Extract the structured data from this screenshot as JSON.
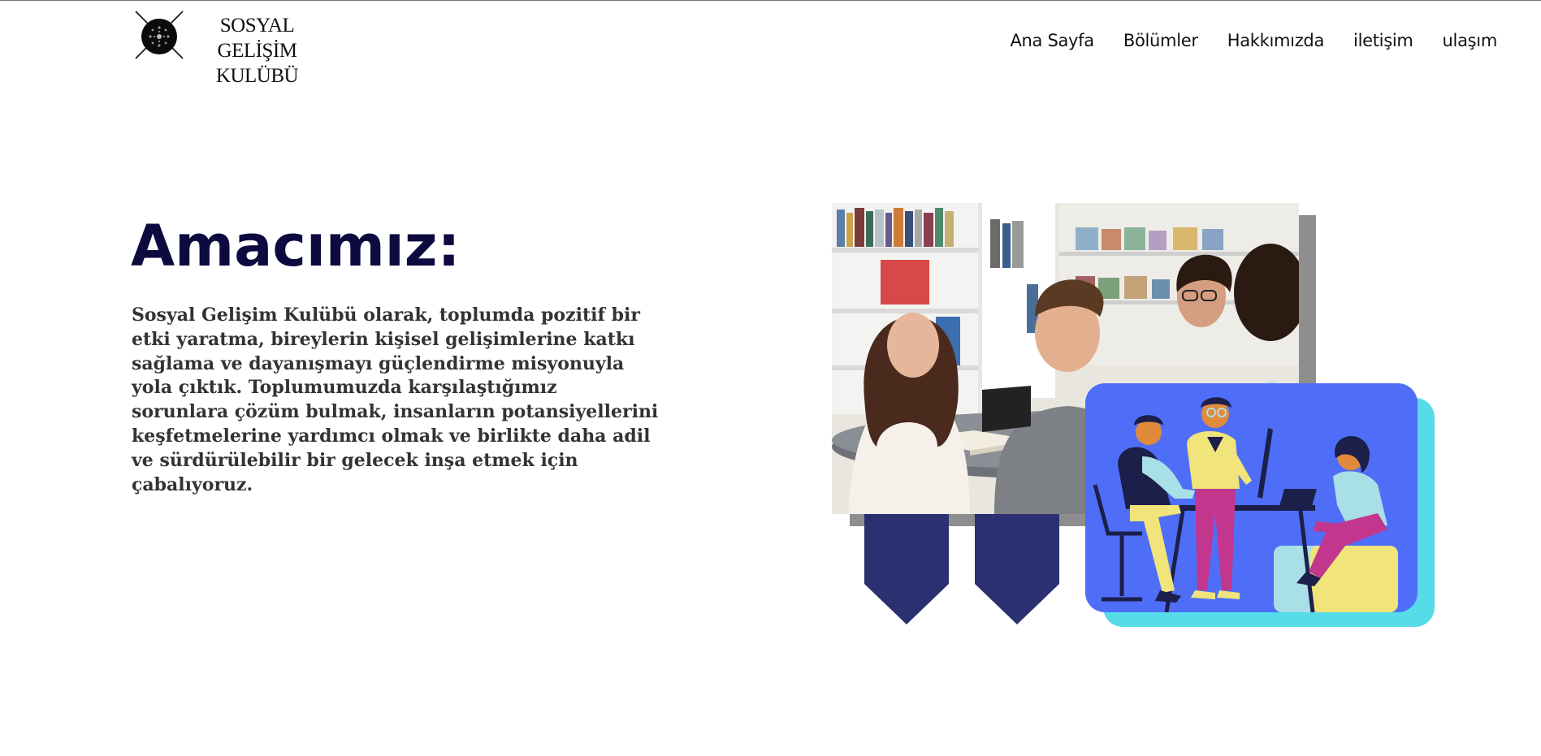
{
  "brand": {
    "line1": "SOSYAL GELİŞİM",
    "line2": "KULÜBÜ"
  },
  "nav": {
    "items": [
      "Ana Sayfa",
      "Bölümler",
      "Hakkımızda",
      "iletişim",
      "ulaşım"
    ]
  },
  "hero": {
    "title": "Amacımız:",
    "description": "Sosyal Gelişim Kulübü olarak, toplumda pozitif bir etki yaratma, bireylerin kişisel gelişimlerine katkı sağlama ve dayanışmayı güçlendirme misyonuyla yola çıktık. Toplumumuzda karşılaştığımız sorunlara çözüm bulmak, insanların potansiyellerini keşfetmelerine yardımcı olmak ve birlikte daha adil ve sürdürülebilir bir gelecek inşa etmek için çabalıyoruz."
  },
  "colors": {
    "title": "#0c0a3e",
    "text": "#333333",
    "ribbon": "#2b3170",
    "illustration_bg": "#4f6ef7",
    "illustration_shadow": "#55dce8",
    "photo_shadow": "#8e8e8e"
  }
}
